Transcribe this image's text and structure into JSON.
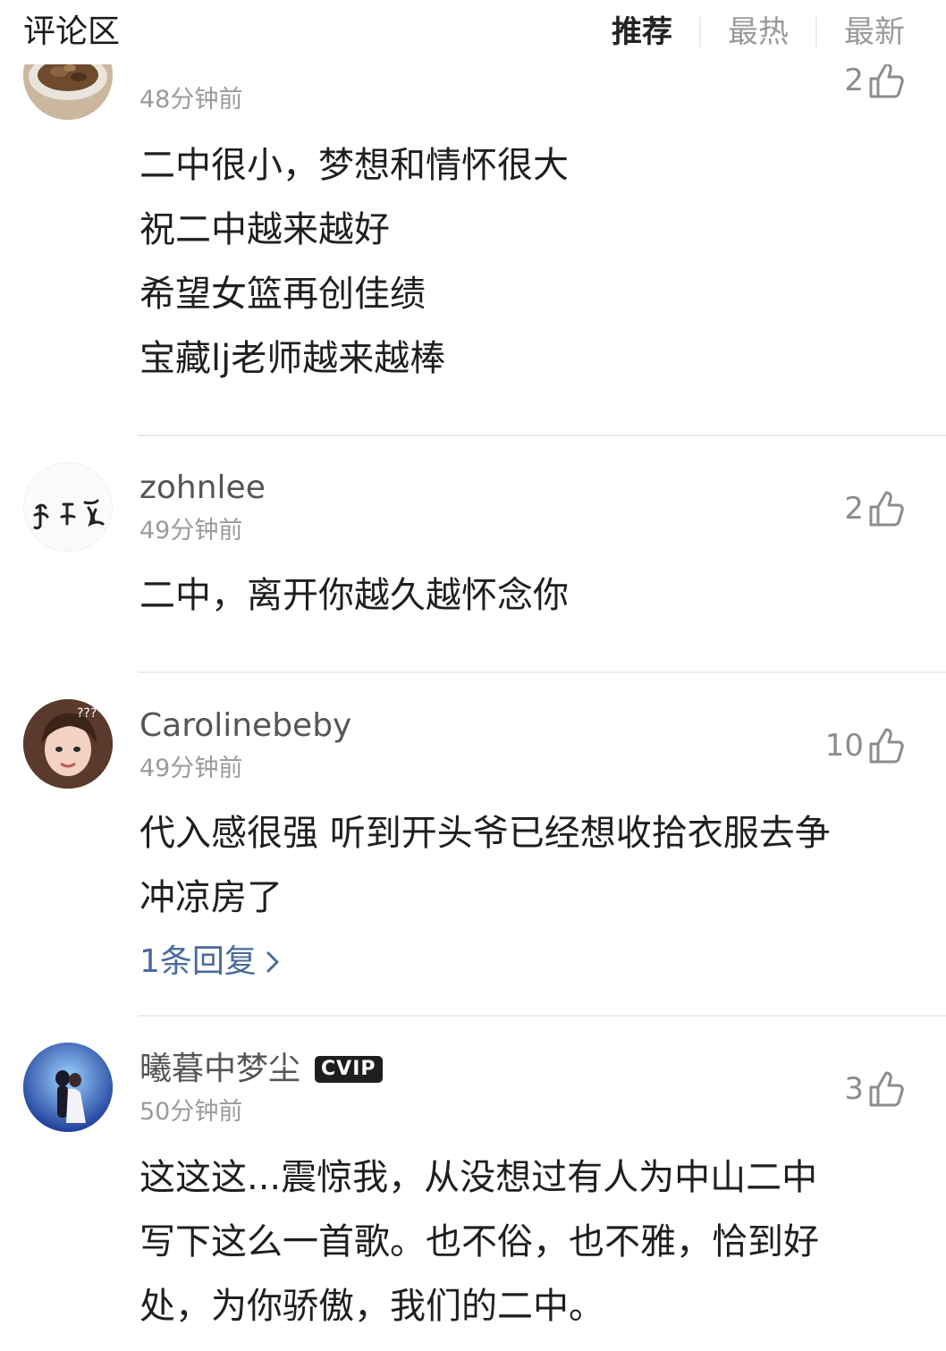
{
  "header": {
    "title": "评论区",
    "tabs": [
      {
        "label": "推荐",
        "active": true
      },
      {
        "label": "最热",
        "active": false
      },
      {
        "label": "最新",
        "active": false
      }
    ]
  },
  "comments": [
    {
      "time": "48分钟前",
      "lines": [
        "二中很小，梦想和情怀很大",
        "祝二中越来越好",
        "希望女篮再创佳绩",
        "宝藏lj老师越来越棒"
      ]
    },
    {
      "username": "zohnlee",
      "avatar_text": "宗理",
      "time": "49分钟前",
      "likes": "2",
      "lines": [
        "二中，离开你越久越怀念你"
      ]
    },
    {
      "username": "Carolinebeby",
      "avatar_text": "???",
      "time": "49分钟前",
      "likes": "10",
      "lines": [
        "代入感很强 听到开头爷已经想收拾衣服去争",
        "冲凉房了"
      ],
      "replies": "1条回复"
    },
    {
      "username": "曦暮中梦尘",
      "badge": "CVIP",
      "time": "50分钟前",
      "likes": "3",
      "lines": [
        "这这这...震惊我，从没想过有人为中山二中",
        "写下这么一首歌。也不俗，也不雅，恰到好",
        "处，为你骄傲，我们的二中。"
      ]
    }
  ],
  "colors": {
    "text_primary": "#1f1f1f",
    "text_secondary": "#9b9b9b",
    "reply_link": "#4a6a9c",
    "divider": "#ececec"
  }
}
